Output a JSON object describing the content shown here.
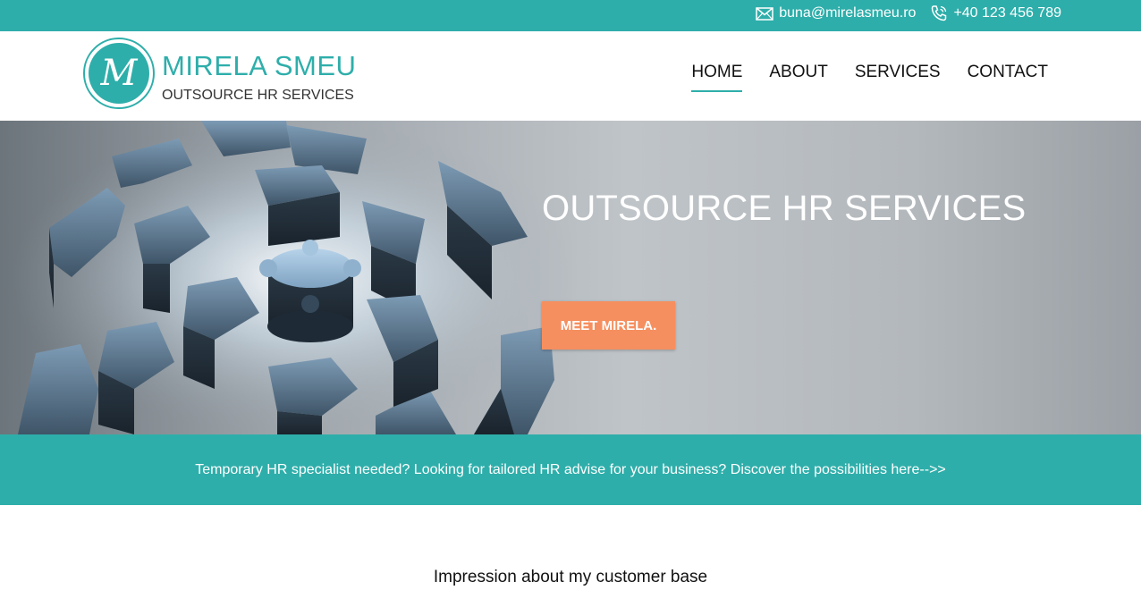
{
  "topbar": {
    "email": "buna@mirelasmeu.ro",
    "phone": "+40 123 456 789",
    "email_icon": "envelope-icon",
    "phone_icon": "phone-icon"
  },
  "logo": {
    "monogram": "M",
    "name": "MIRELA SMEU",
    "tagline": "OUTSOURCE HR SERVICES"
  },
  "nav": {
    "items": [
      {
        "label": "HOME",
        "active": true
      },
      {
        "label": "ABOUT",
        "active": false
      },
      {
        "label": "SERVICES",
        "active": false
      },
      {
        "label": "CONTACT",
        "active": false
      }
    ]
  },
  "hero": {
    "title": "OUTSOURCE HR SERVICES",
    "button_label": "MEET MIRELA."
  },
  "banner": {
    "text": "Temporary HR specialist needed? Looking for tailored HR advise for your business? Discover the possibilities here-->>"
  },
  "section": {
    "title": "Impression about my customer base"
  },
  "colors": {
    "accent": "#2eaeaa",
    "button": "#f58f5f"
  }
}
